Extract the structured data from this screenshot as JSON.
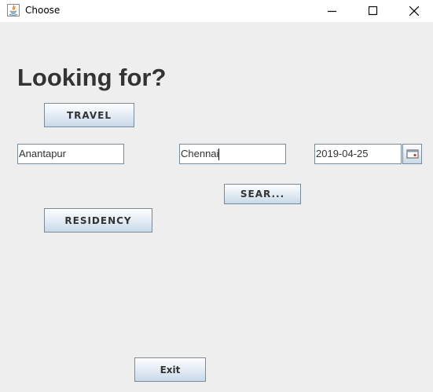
{
  "window": {
    "title": "Choose",
    "app_icon": "java-icon",
    "controls": [
      "minimize-icon",
      "maximize-icon",
      "close-icon"
    ]
  },
  "main": {
    "heading": "Looking for?",
    "travel_button": "TRAVEL",
    "from_field": {
      "value": "Anantapur"
    },
    "to_field": {
      "value": "Chennai"
    },
    "date_field": {
      "value": "2019-04-25"
    },
    "calendar_button_icon": "calendar-icon",
    "search_button": "SEAR...",
    "residency_button": "RESIDENCY",
    "exit_button": "Exit"
  },
  "colors": {
    "window_bg": "#eeeeee",
    "titlebar_bg": "#ffffff",
    "button_border": "#7a8a99",
    "button_gradient_top": "#fdfeff",
    "button_gradient_bottom": "#c9d9e8",
    "text": "#333333"
  }
}
